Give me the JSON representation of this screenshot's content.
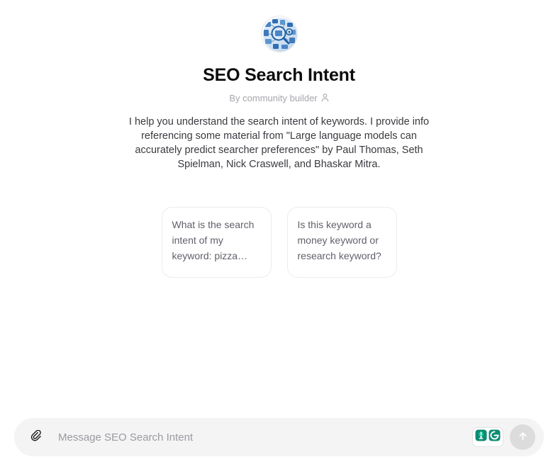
{
  "gpt": {
    "avatar_icon": "seo-search-intent-logo",
    "title": "SEO Search Intent",
    "byline": "By community builder",
    "byline_icon": "person-icon",
    "description": "I help you understand the search intent of keywords. I provide info referencing some material from \"Large language models can accurately predict searcher preferences\" by Paul Thomas, Seth Spielman, Nick Craswell, and Bhaskar Mitra."
  },
  "starters": [
    {
      "text": "What is the search intent of my keyword: pizza…"
    },
    {
      "text": "Is this keyword a money keyword or research keyword?"
    }
  ],
  "composer": {
    "attach_icon": "paperclip-icon",
    "placeholder": "Message SEO Search Intent",
    "value": "",
    "grammarly": {
      "bulb_icon": "lightbulb-icon",
      "logo_icon": "grammarly-g-icon"
    },
    "send_icon": "arrow-up-icon"
  },
  "colors": {
    "background": "#ffffff",
    "title": "#0d0d0d",
    "muted": "#a6a6ad",
    "card_border": "#ececef",
    "composer_bg": "#f4f4f4",
    "send_disabled": "#dcdcdc",
    "grammarly_green": "#15c39a",
    "grammarly_dark": "#0b8b72",
    "logo_blue": "#2d6fb5"
  }
}
